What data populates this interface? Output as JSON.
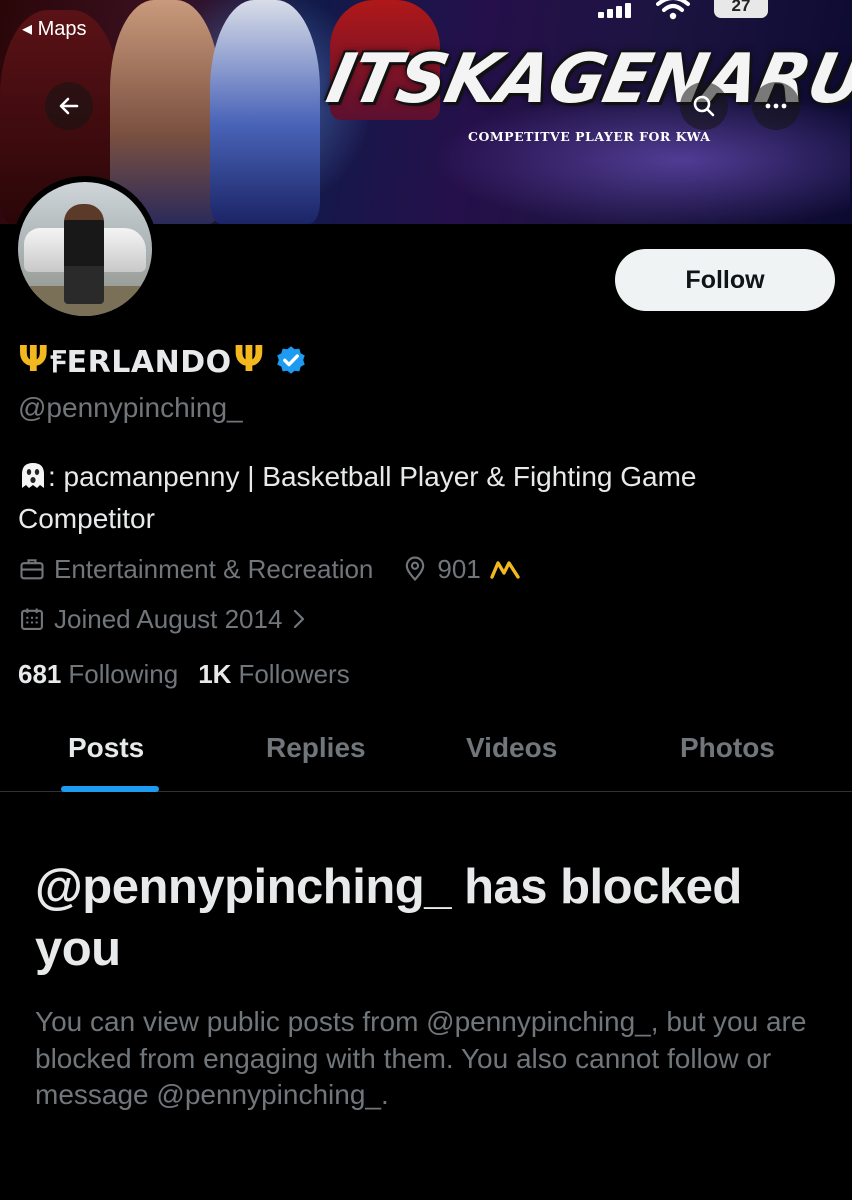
{
  "status_bar": {
    "back_app_label": "◂ Maps",
    "battery": "27"
  },
  "banner": {
    "title": "ITSKAGENARU",
    "subtitle": "COMPETITVE PLAYER FOR KWA"
  },
  "profile": {
    "display_name": "ꞘERLANDO",
    "trident_symbol": "Ψ",
    "handle": "@pennypinching_",
    "bio": ": pacmanpenny | Basketball Player & Fighting Game Competitor",
    "category": "Entertainment & Recreation",
    "location": "901",
    "joined": "Joined August 2014",
    "following_count": "681",
    "following_label": "Following",
    "followers_count": "1K",
    "followers_label": "Followers",
    "follow_button": "Follow"
  },
  "tabs": [
    {
      "label": "Posts",
      "active": true
    },
    {
      "label": "Replies",
      "active": false
    },
    {
      "label": "Videos",
      "active": false
    },
    {
      "label": "Photos",
      "active": false
    }
  ],
  "blocked_notice": {
    "title": "@pennypinching_ has blocked you",
    "body": "You can view public posts from @pennypinching_, but you are blocked from engaging with them. You also cannot follow or message @pennypinching_."
  },
  "colors": {
    "background": "#000000",
    "primary_text": "#e7e9ea",
    "secondary_text": "#71767b",
    "accent_blue": "#1d9bf0",
    "verified_badge": "#1d9bf0",
    "gold": "#f2b81d"
  },
  "icons": {
    "back": "arrow-left-icon",
    "search": "search-icon",
    "more": "more-horizontal-icon",
    "verified": "verified-badge-icon",
    "category": "briefcase-icon",
    "location": "location-pin-icon",
    "joined": "calendar-icon",
    "ghost": "ghost-emoji-icon",
    "crown": "crown-icon"
  }
}
